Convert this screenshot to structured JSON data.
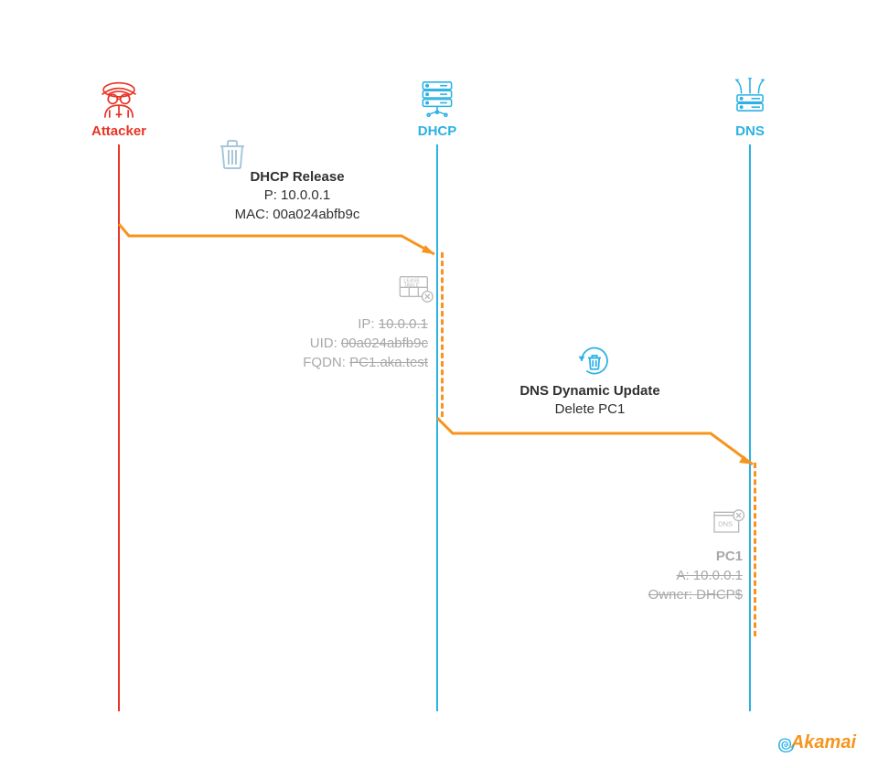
{
  "lanes": {
    "attacker": {
      "label": "Attacker"
    },
    "dhcp": {
      "label": "DHCP"
    },
    "dns": {
      "label": "DNS"
    }
  },
  "msg1": {
    "title": "DHCP Release",
    "line1": "P: 10.0.0.1",
    "line2": "MAC: 00a024abfb9c"
  },
  "lease": {
    "ip_label": "IP:",
    "ip_value": "10.0.0.1",
    "uid_label": "UID:",
    "uid_value": "00a024abfb9c",
    "fqdn_label": "FQDN:",
    "fqdn_value": "PC1.aka.test"
  },
  "msg2": {
    "title": "DNS Dynamic Update",
    "line1": "Delete PC1"
  },
  "dns_rec": {
    "host": "PC1",
    "a": "A: 10.0.0.1",
    "owner": "Owner: DHCP$"
  },
  "logo": {
    "text": "Akamai"
  },
  "icons": {
    "attacker": "spy-icon",
    "dhcp": "server-stack-icon",
    "dns": "dns-branch-icon",
    "trash": "trash-icon",
    "lease": "lease-table-icon",
    "reload_trash": "refresh-trash-icon",
    "dns_record": "dns-record-icon"
  },
  "colors": {
    "red": "#e93323",
    "blue": "#2bb1e5",
    "orange": "#f7941d",
    "grey": "#a8a8a8"
  }
}
